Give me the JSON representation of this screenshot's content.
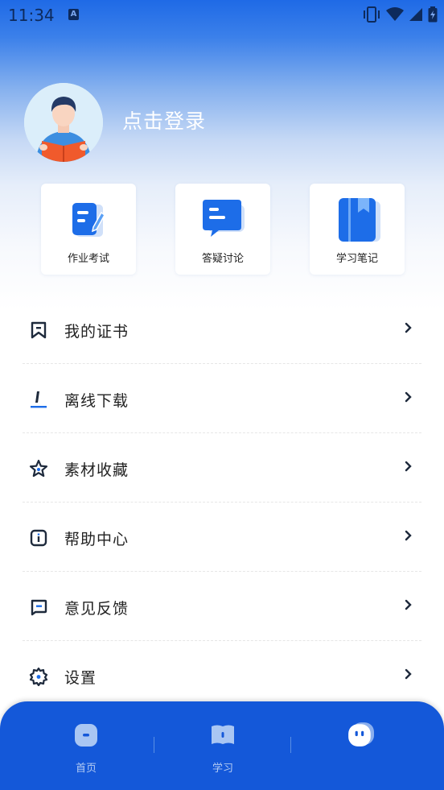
{
  "status_bar": {
    "time": "11:34",
    "notif_letter": "A"
  },
  "profile": {
    "login_label": "点击登录"
  },
  "quick_cards": [
    {
      "label": "作业考试",
      "icon": "homework-exam-icon"
    },
    {
      "label": "答疑讨论",
      "icon": "chat-discussion-icon"
    },
    {
      "label": "学习笔记",
      "icon": "notebook-icon"
    }
  ],
  "menu": [
    {
      "label": "我的证书",
      "icon": "bookmark-icon"
    },
    {
      "label": "离线下载",
      "icon": "download-icon"
    },
    {
      "label": "素材收藏",
      "icon": "star-icon"
    },
    {
      "label": "帮助中心",
      "icon": "info-icon"
    },
    {
      "label": "意见反馈",
      "icon": "feedback-icon"
    },
    {
      "label": "设置",
      "icon": "gear-icon"
    }
  ],
  "tabbar": [
    {
      "label": "首页",
      "icon": "home-icon"
    },
    {
      "label": "学习",
      "icon": "book-icon"
    },
    {
      "label": "",
      "icon": "mascot-icon",
      "active": true
    }
  ],
  "colors": {
    "accent": "#1458d9",
    "hero_top": "#1f6ae6",
    "text": "#222222"
  }
}
